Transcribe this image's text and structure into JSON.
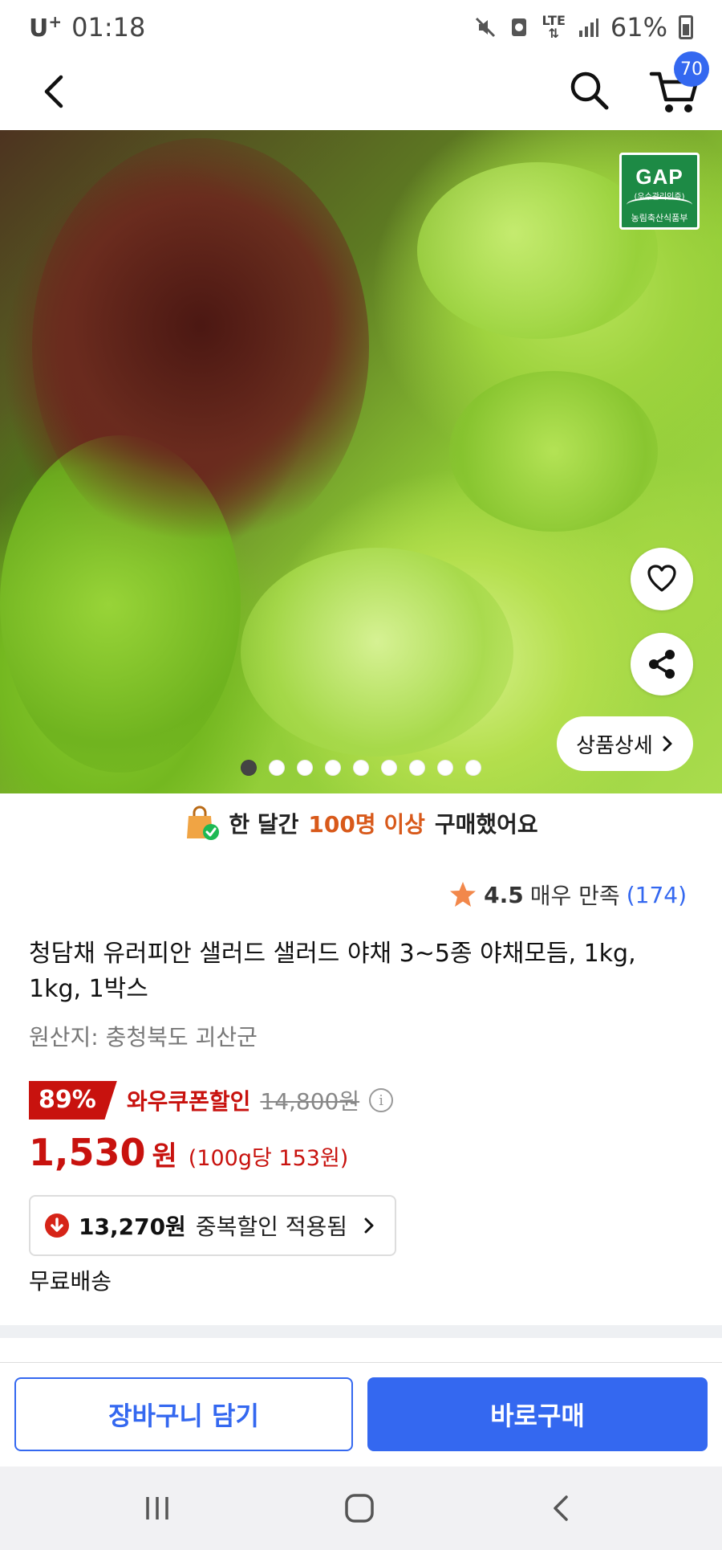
{
  "status_bar": {
    "carrier": "U",
    "carrier_sup": "+",
    "time": "01:18",
    "network": "LTE",
    "battery": "61%"
  },
  "header": {
    "cart_count": "70",
    "icons": [
      "back-arrow-icon",
      "search-icon",
      "cart-icon"
    ]
  },
  "hero": {
    "gap_logo": {
      "title": "GAP",
      "subtitle": "(우수관리인증)",
      "org": "농림축산식품부"
    },
    "detail_button": "상품상세",
    "slide_count": 9,
    "active_slide": 1
  },
  "purchase_banner": {
    "prefix": "한 달간",
    "highlight": "100명 이상",
    "suffix": "구매했어요"
  },
  "rating": {
    "score": "4.5",
    "label": "매우 만족",
    "count": "(174)"
  },
  "product": {
    "title": "청담채 유러피안 샐러드 샐러드 야채 3~5종 야채모듬, 1kg, 1kg, 1박스",
    "origin": "원산지: 충청북도 괴산군"
  },
  "price": {
    "discount_rate": "89%",
    "coupon_label": "와우쿠폰할인",
    "original_price": "14,800원",
    "sale_price": "1,530",
    "currency": "원",
    "unit_price": "(100g당 153원)",
    "extra_discount_amount": "13,270원",
    "extra_discount_label": "중복할인 적용됨"
  },
  "shipping": {
    "label": "무료배송"
  },
  "actions": {
    "add_to_cart": "장바구니 담기",
    "buy_now": "바로구매"
  },
  "colors": {
    "accent_blue": "#3468f0",
    "discount_red": "#c8120e",
    "highlight_orange": "#d8591a"
  }
}
